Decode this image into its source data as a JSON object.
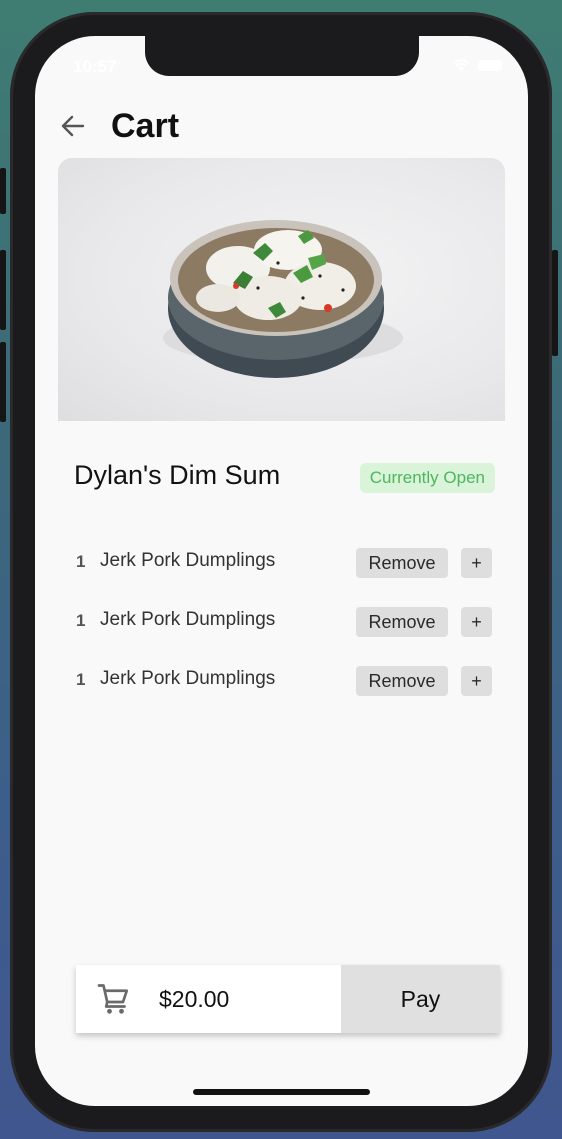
{
  "status_bar": {
    "time": "10:57"
  },
  "header": {
    "title": "Cart"
  },
  "restaurant": {
    "name": "Dylan's Dim Sum",
    "status": "Currently Open",
    "status_color": "#4fb55f"
  },
  "cart": {
    "items": [
      {
        "qty": "1",
        "name": "Jerk Pork Dumplings",
        "remove_label": "Remove",
        "add_label": "+"
      },
      {
        "qty": "1",
        "name": "Jerk Pork Dumplings",
        "remove_label": "Remove",
        "add_label": "+"
      },
      {
        "qty": "1",
        "name": "Jerk Pork Dumplings",
        "remove_label": "Remove",
        "add_label": "+"
      }
    ]
  },
  "checkout": {
    "total": "$20.00",
    "pay_label": "Pay"
  }
}
